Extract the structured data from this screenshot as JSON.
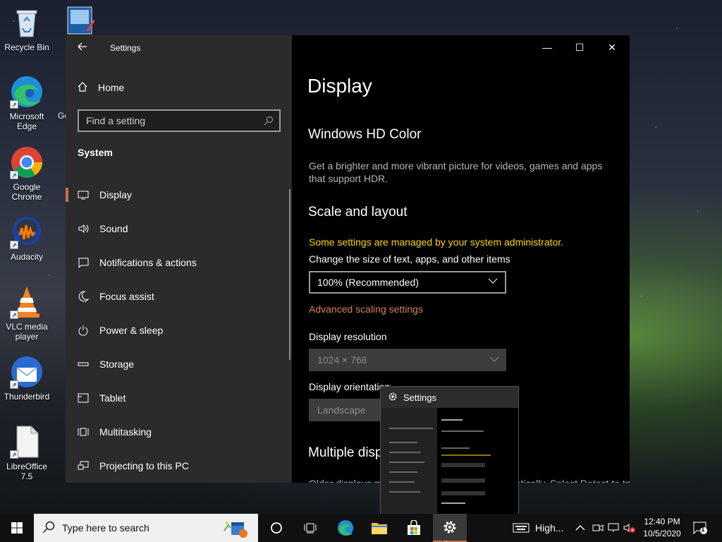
{
  "desktop": {
    "icons": [
      {
        "label": "Recycle Bin",
        "icon": "recycle-bin-icon"
      },
      {
        "label": "Microsoft Edge",
        "icon": "edge-icon"
      },
      {
        "label": "Google Chrome",
        "icon": "chrome-icon"
      },
      {
        "label": "Audacity",
        "icon": "audacity-icon"
      },
      {
        "label": "VLC media player",
        "icon": "vlc-icon"
      },
      {
        "label": "Thunderbird",
        "icon": "thunderbird-icon"
      },
      {
        "label": "LibreOffice 7.5",
        "icon": "libreoffice-icon"
      }
    ],
    "partial_label": "Go"
  },
  "window": {
    "title": "Settings",
    "sidebar": {
      "home": "Home",
      "search_placeholder": "Find a setting",
      "section": "System",
      "items": [
        {
          "label": "Display",
          "icon": "monitor-icon",
          "active": true
        },
        {
          "label": "Sound",
          "icon": "speaker-icon"
        },
        {
          "label": "Notifications & actions",
          "icon": "notification-icon"
        },
        {
          "label": "Focus assist",
          "icon": "moon-icon"
        },
        {
          "label": "Power & sleep",
          "icon": "power-icon"
        },
        {
          "label": "Storage",
          "icon": "storage-icon"
        },
        {
          "label": "Tablet",
          "icon": "tablet-icon"
        },
        {
          "label": "Multitasking",
          "icon": "multitasking-icon"
        },
        {
          "label": "Projecting to this PC",
          "icon": "projecting-icon"
        }
      ]
    },
    "main": {
      "page_title": "Display",
      "hdr_heading": "Windows HD Color",
      "hdr_text": "Get a brighter and more vibrant picture for videos, games and apps that support HDR.",
      "scale_heading": "Scale and layout",
      "admin_warning": "Some settings are managed by your system administrator.",
      "scale_label": "Change the size of text, apps, and other items",
      "scale_value": "100% (Recommended)",
      "advanced_link": "Advanced scaling settings",
      "resolution_label": "Display resolution",
      "resolution_value": "1024 × 768",
      "orientation_label": "Display orientation",
      "orientation_value": "Landscape",
      "multiple_heading": "Multiple displays",
      "multiple_text": "Older displays might not always connect automatically. Select Detect to try to connect to them."
    }
  },
  "thumbnail": {
    "title": "Settings"
  },
  "taskbar": {
    "search_placeholder": "Type here to search",
    "tray_label": "High...",
    "time": "12:40 PM",
    "date": "10/5/2020",
    "notification_count": "1"
  },
  "colors": {
    "accent": "#c96f46",
    "warning": "#ffd400",
    "link": "#d98158"
  }
}
